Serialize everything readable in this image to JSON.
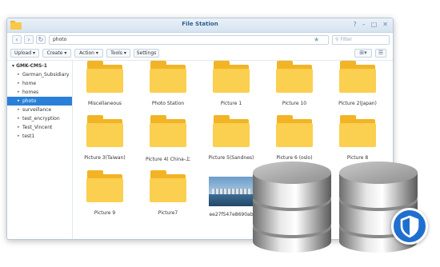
{
  "window": {
    "title": "File Station",
    "controls": [
      "?",
      "–",
      "□",
      "✕"
    ]
  },
  "nav": {
    "back_icon": "‹",
    "forward_icon": "›",
    "refresh_icon": "↻",
    "path": "photo",
    "filter_placeholder": "Filter"
  },
  "toolbar": {
    "upload": "Upload ▾",
    "create": "Create ▾",
    "action": "Action ▾",
    "tools": "Tools ▾",
    "settings": "Settings"
  },
  "sidebar": {
    "root": "▾ GMK-CMS-1",
    "items": [
      {
        "label": "German_Subsidiary",
        "selected": false
      },
      {
        "label": "home",
        "selected": false
      },
      {
        "label": "homes",
        "selected": false
      },
      {
        "label": "photo",
        "selected": true
      },
      {
        "label": "surveillance",
        "selected": false
      },
      {
        "label": "test_encryption",
        "selected": false
      },
      {
        "label": "Test_Vincent",
        "selected": false
      },
      {
        "label": "test1",
        "selected": false
      }
    ]
  },
  "files": [
    {
      "name": "Miscellaneous",
      "type": "folder"
    },
    {
      "name": "Photo Station",
      "type": "folder"
    },
    {
      "name": "Picture 1",
      "type": "folder"
    },
    {
      "name": "Picture 10",
      "type": "folder"
    },
    {
      "name": "Picture 2(Japan)",
      "type": "folder"
    },
    {
      "name": "Picture 3(Taiwan)",
      "type": "folder"
    },
    {
      "name": "Picture 4( China-上",
      "type": "folder"
    },
    {
      "name": "Picture 5(Sandnes)",
      "type": "folder"
    },
    {
      "name": "Picture 6 (oslo)",
      "type": "folder"
    },
    {
      "name": "Picture 8",
      "type": "folder"
    },
    {
      "name": "Picture 9",
      "type": "folder"
    },
    {
      "name": "Picture7",
      "type": "folder"
    },
    {
      "name": "ee27f547e8690ab",
      "type": "image"
    }
  ],
  "icons": {
    "app": "folder-icon",
    "star": "star-icon",
    "search": "search-icon",
    "grid_view": "grid-view-icon",
    "list_view": "list-view-icon",
    "database": "database-icon",
    "shield": "shield-icon"
  },
  "colors": {
    "accent": "#2a80d8",
    "folder": "#fbcf4f",
    "shield_badge": "#1f6fcf"
  }
}
